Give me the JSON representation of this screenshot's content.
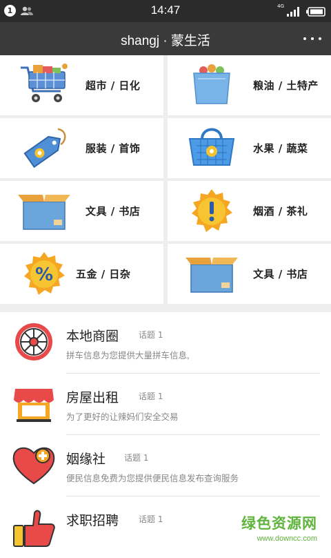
{
  "status_bar": {
    "notification_count": "1",
    "time": "14:47",
    "network": "4G",
    "icons": [
      "notification-badge-icon",
      "contacts-icon",
      "signal-icon",
      "battery-icon"
    ]
  },
  "header": {
    "title": "shangj · 蒙生活",
    "more_icon": "more-dots-icon"
  },
  "categories": [
    {
      "label": "超市 / 日化",
      "icon": "shopping-cart-icon"
    },
    {
      "label": "粮油 / 土特产",
      "icon": "grocery-bag-icon"
    },
    {
      "label": "服装 / 首饰",
      "icon": "price-tag-icon"
    },
    {
      "label": "水果 / 蔬菜",
      "icon": "basket-icon"
    },
    {
      "label": "文具 / 书店",
      "icon": "open-box-icon"
    },
    {
      "label": "烟酒 / 茶礼",
      "icon": "warning-badge-icon"
    },
    {
      "label": "五金 / 日杂",
      "icon": "percent-badge-icon"
    },
    {
      "label": "文具 / 书店",
      "icon": "open-box-icon"
    }
  ],
  "forums": [
    {
      "title": "本地商圈",
      "topic": "话题 1",
      "desc": "拼车信息为您提供大量拼车信息,",
      "icon": "wheel-icon"
    },
    {
      "title": "房屋出租",
      "topic": "话题 1",
      "desc": "为了更好的让辣妈们安全交易",
      "icon": "storefront-icon"
    },
    {
      "title": "姻缘社",
      "topic": "话题 1",
      "desc": "便民信息免费为您提供便民信息发布查询服务",
      "icon": "heart-plus-icon"
    },
    {
      "title": "求职招聘",
      "topic": "话题 1",
      "desc": "",
      "icon": "thumbs-up-icon"
    }
  ],
  "watermark": {
    "name": "绿色资源网",
    "url": "www.downcc.com"
  },
  "colors": {
    "status_bar": "#2b2b2b",
    "header": "#3a3a3a",
    "accent_red": "#e84a4a",
    "watermark_green": "#5fb43c"
  }
}
